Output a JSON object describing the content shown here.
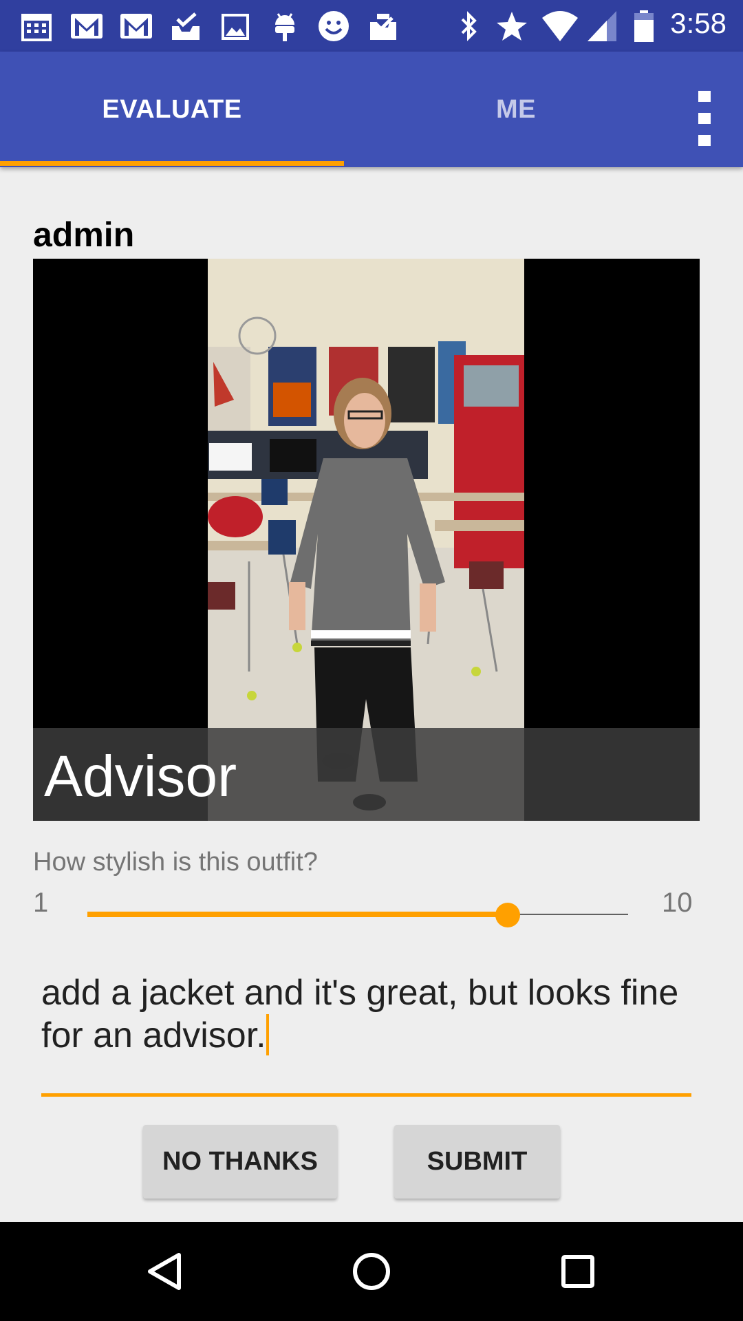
{
  "status_bar": {
    "time": "3:58",
    "notification_icons": [
      "calendar-icon",
      "gmail-icon",
      "gmail-icon",
      "inbox-icon",
      "image-icon",
      "android-icon",
      "smiley-icon",
      "clipboard-check-icon"
    ],
    "system_icons": [
      "bluetooth-icon",
      "star-icon",
      "wifi-icon",
      "cell-signal-icon",
      "battery-icon"
    ]
  },
  "app_bar": {
    "tabs": [
      {
        "label": "EVALUATE",
        "selected": true
      },
      {
        "label": "ME",
        "selected": false
      }
    ],
    "overflow_icon": "more-vert-icon",
    "colors": {
      "primary": "#3f51b5",
      "status": "#303f9f",
      "accent": "#ffa000"
    }
  },
  "post": {
    "username": "admin",
    "photo_caption": "Advisor"
  },
  "rating": {
    "question": "How stylish is this outfit?",
    "min_label": "1",
    "max_label": "10",
    "min": 1,
    "max": 10,
    "value": 8
  },
  "comment": {
    "text": "add a jacket and it's great, but looks fine for an advisor."
  },
  "buttons": {
    "no_thanks": "NO THANKS",
    "submit": "SUBMIT"
  },
  "nav_bar": {
    "icons": [
      "back-icon",
      "home-icon",
      "recents-icon"
    ]
  }
}
